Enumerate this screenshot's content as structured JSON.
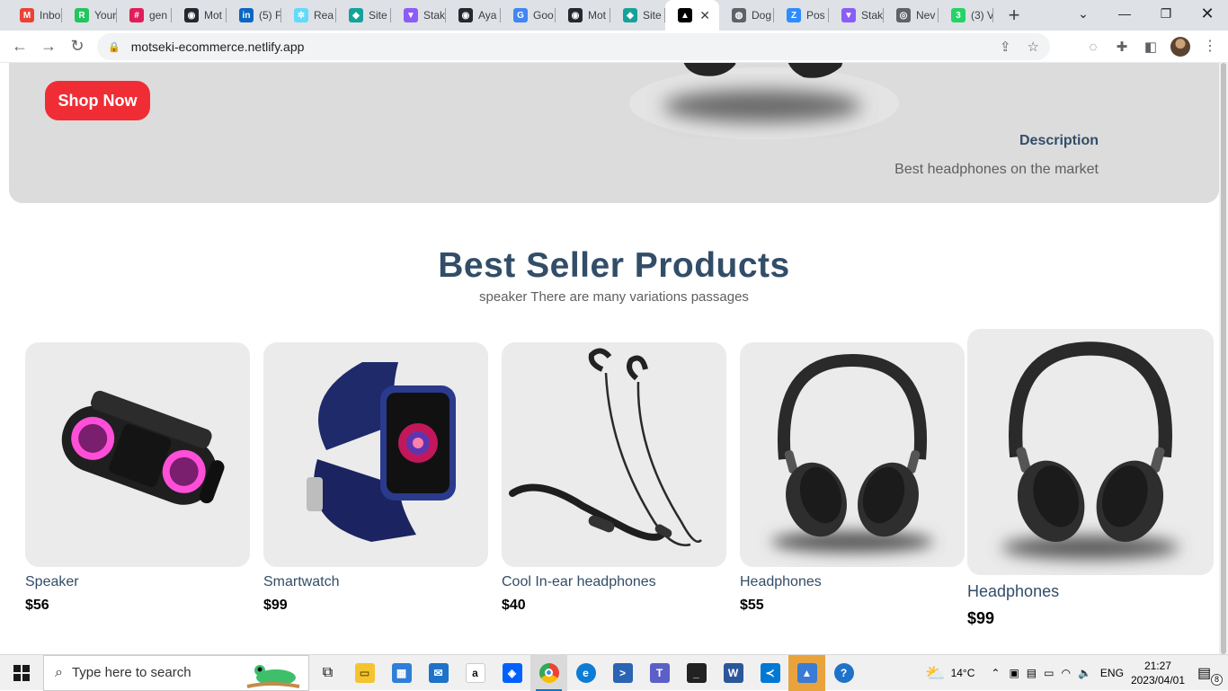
{
  "browser": {
    "tabs": [
      {
        "label": "Inbo",
        "icon": "gmail-icon",
        "color": "#ea4335",
        "glyph": "M"
      },
      {
        "label": "Your",
        "icon": "app-icon",
        "color": "#22c55e",
        "glyph": "R"
      },
      {
        "label": "gen",
        "icon": "slack-icon",
        "color": "#e01e5a",
        "glyph": "#"
      },
      {
        "label": "Mot",
        "icon": "github-icon",
        "color": "#24292f",
        "glyph": "◉"
      },
      {
        "label": "(5) F",
        "icon": "linkedin-icon",
        "color": "#0a66c2",
        "glyph": "in"
      },
      {
        "label": "Rea",
        "icon": "react-icon",
        "color": "#61dafb",
        "glyph": "✲"
      },
      {
        "label": "Site",
        "icon": "netlify-icon",
        "color": "#15a29b",
        "glyph": "◆"
      },
      {
        "label": "Stak",
        "icon": "vite-icon",
        "color": "#8b5cf6",
        "glyph": "▼"
      },
      {
        "label": "Aya",
        "icon": "github-icon",
        "color": "#24292f",
        "glyph": "◉"
      },
      {
        "label": "Goo",
        "icon": "google-icon",
        "color": "#4285f4",
        "glyph": "G"
      },
      {
        "label": "Mot",
        "icon": "github-icon",
        "color": "#24292f",
        "glyph": "◉"
      },
      {
        "label": "Site",
        "icon": "netlify-icon",
        "color": "#15a29b",
        "glyph": "◆"
      },
      {
        "label": "",
        "icon": "sanity-icon",
        "color": "#000000",
        "glyph": "▲",
        "active": true
      },
      {
        "label": "Dog",
        "icon": "globe-icon",
        "color": "#5f6368",
        "glyph": "◍"
      },
      {
        "label": "Pos",
        "icon": "zoom-icon",
        "color": "#2d8cff",
        "glyph": "Z"
      },
      {
        "label": "Stak",
        "icon": "vite-icon",
        "color": "#8b5cf6",
        "glyph": "▼"
      },
      {
        "label": "Nev",
        "icon": "chrome-icon",
        "color": "#5f6368",
        "glyph": "◎"
      },
      {
        "label": "(3) V",
        "icon": "whatsapp-icon",
        "color": "#25d366",
        "glyph": "3"
      }
    ],
    "url": "motseki-ecommerce.netlify.app"
  },
  "hero": {
    "button_label": "Shop Now",
    "desc_title": "Description",
    "desc_text": "Best headphones on the market"
  },
  "section": {
    "title": "Best Seller Products",
    "subtitle": "speaker There are many variations passages"
  },
  "products": [
    {
      "name": "Speaker",
      "price": "$56",
      "image": "speaker-image"
    },
    {
      "name": "Smartwatch",
      "price": "$99",
      "image": "smartwatch-image"
    },
    {
      "name": "Cool In-ear headphones",
      "price": "$40",
      "image": "earphones-image"
    },
    {
      "name": "Headphones",
      "price": "$55",
      "image": "headphones-image"
    },
    {
      "name": "Headphones",
      "price": "$99",
      "image": "headphones-image",
      "hovered": true
    }
  ],
  "taskbar": {
    "search_placeholder": "Type here to search",
    "weather": "14°C",
    "language": "ENG",
    "time": "21:27",
    "date": "2023/04/01",
    "notifications": "8"
  }
}
